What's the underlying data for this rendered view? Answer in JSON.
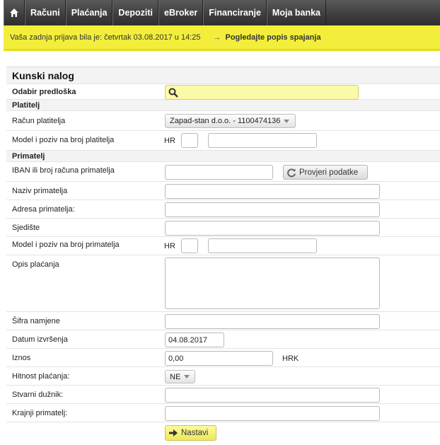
{
  "nav": {
    "items": [
      "Računi",
      "Plaćanja",
      "Depoziti",
      "eBroker",
      "Financiranje",
      "Moja banka"
    ]
  },
  "infobar": {
    "last_login": "Vaša zadnja prijava bila je: četvrtak 03.08.2017 u 14:25",
    "link_arrow": "→",
    "link_label": "Pogledajte popis spajanja"
  },
  "form": {
    "title": "Kunski nalog",
    "template_label": "Odabir predloška",
    "payer_section": "Platitelj",
    "payer_account_label": "Račun platitelja",
    "payer_account_value": "Zapad-stan d.o.o. - 1100474136",
    "payer_model_label": "Model i poziv na broj platitelja",
    "hr_prefix": "HR",
    "recipient_section": "Primatelj",
    "iban_label": "IBAN ili broj računa primatelja",
    "check_button": "Provjeri podatke",
    "recipient_name_label": "Naziv primatelja",
    "recipient_address_label": "Adresa primatelja:",
    "seat_label": "Sjedište",
    "recipient_model_label": "Model i poziv na broj primatelja",
    "description_label": "Opis plaćanja",
    "purpose_code_label": "Šifra namjene",
    "execution_date_label": "Datum izvršenja",
    "execution_date_value": "04.08.2017",
    "amount_label": "Iznos",
    "amount_value": "0,00",
    "currency": "HRK",
    "urgency_label": "Hitnost plaćanja:",
    "urgency_value": "NE",
    "actual_debtor_label": "Stvarni dužnik:",
    "final_recipient_label": "Krajnji primatelj:",
    "continue_button": "Nastavi"
  },
  "colors": {
    "nav_bg": "#3d3d3d",
    "info_bar": "#f2ee3b",
    "search_bg": "#fafaa8",
    "button_yellow": "#f2ee60"
  }
}
